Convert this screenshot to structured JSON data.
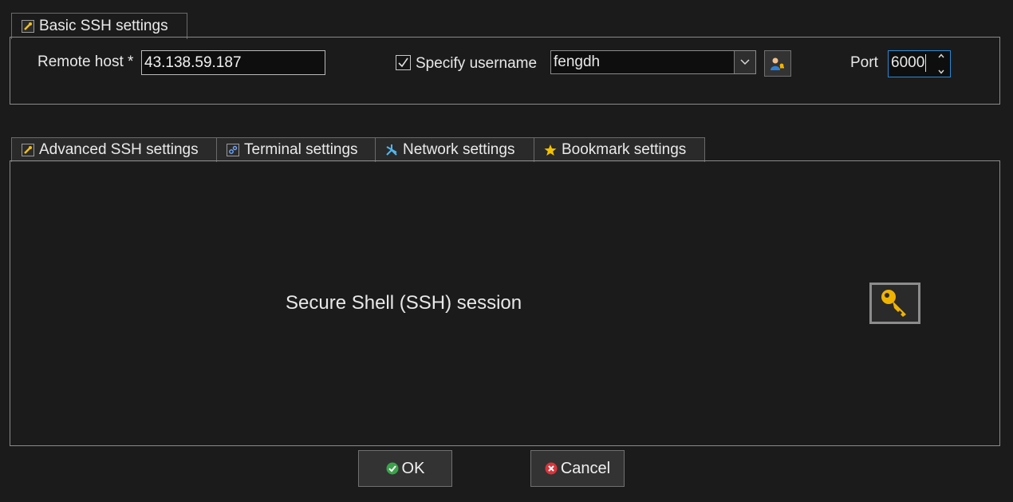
{
  "basic_tab": {
    "label": "Basic SSH settings"
  },
  "basic": {
    "remote_host_label": "Remote host *",
    "remote_host_value": "43.138.59.187",
    "specify_username_label": "Specify username",
    "specify_username_checked": true,
    "username_value": "fengdh",
    "port_label": "Port",
    "port_value": "6000"
  },
  "tabs": [
    {
      "label": "Advanced SSH settings",
      "icon": "wrench-icon"
    },
    {
      "label": "Terminal settings",
      "icon": "terminal-icon"
    },
    {
      "label": "Network settings",
      "icon": "network-icon"
    },
    {
      "label": "Bookmark settings",
      "icon": "star-icon"
    }
  ],
  "main": {
    "session_title": "Secure Shell (SSH) session",
    "session_icon": "key-icon"
  },
  "footer": {
    "ok_label": "OK",
    "cancel_label": "Cancel"
  },
  "colors": {
    "background": "#1b1b1b",
    "ok_icon": "#3aa34a",
    "cancel_icon": "#d9343a",
    "key": "#f0b400"
  }
}
